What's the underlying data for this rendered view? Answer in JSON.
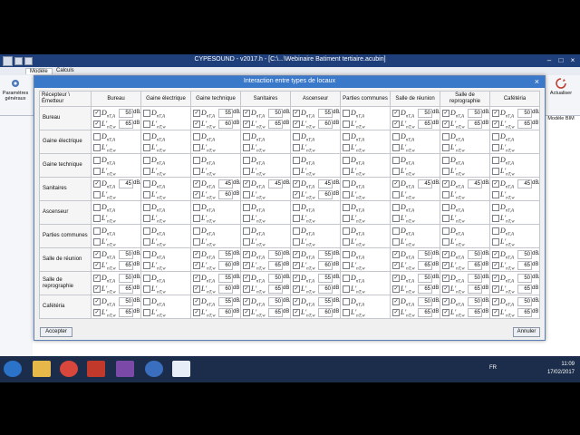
{
  "app": {
    "title": "CYPESOUND - v2017.h - [C:\\...\\Webinaire Batiment tertiaire.acubin]",
    "ribbon_tabs": [
      "Modèle",
      "Calculs"
    ],
    "ribbon_left_label": "Paramètres généraux",
    "ribbon_right_labels": [
      "Actualiser",
      "Modèle BIM"
    ]
  },
  "dialog": {
    "title": "Interaction entre types de locaux",
    "corner": "Récepteur \\ Émetteur",
    "accept_label": "Accepter",
    "cancel_label": "Annuler",
    "col_headers": [
      "Bureau",
      "Gaine électrique",
      "Gaine technique",
      "Sanitaires",
      "Ascenseur",
      "Parties communes",
      "Salle de réunion",
      "Salle de reprographie",
      "Cafétéria"
    ],
    "row_headers": [
      "Bureau",
      "Gaine électrique",
      "Gaine technique",
      "Sanitaires",
      "Ascenseur",
      "Parties communes",
      "Salle de réunion",
      "Salle de reprographie",
      "Cafétéria"
    ],
    "sym_d": "D",
    "sym_d_sub": "nT,A",
    "sym_l": "L'",
    "sym_l_sub": "nT,w",
    "unit_d": "dBA",
    "unit_l": "dB",
    "rows": [
      [
        {
          "d": "50",
          "l": "65"
        },
        {
          "d": "",
          "l": ""
        },
        {
          "d": "55",
          "l": "60"
        },
        {
          "d": "50",
          "l": "65"
        },
        {
          "d": "55",
          "l": "60"
        },
        {
          "d": "",
          "l": ""
        },
        {
          "d": "50",
          "l": "65"
        },
        {
          "d": "50",
          "l": "65"
        },
        {
          "d": "50",
          "l": "65"
        }
      ],
      [
        {
          "d": "",
          "l": ""
        },
        {
          "d": "",
          "l": ""
        },
        {
          "d": "",
          "l": ""
        },
        {
          "d": "",
          "l": ""
        },
        {
          "d": "",
          "l": ""
        },
        {
          "d": "",
          "l": ""
        },
        {
          "d": "",
          "l": ""
        },
        {
          "d": "",
          "l": ""
        },
        {
          "d": "",
          "l": ""
        }
      ],
      [
        {
          "d": "",
          "l": ""
        },
        {
          "d": "",
          "l": ""
        },
        {
          "d": "",
          "l": ""
        },
        {
          "d": "",
          "l": ""
        },
        {
          "d": "",
          "l": ""
        },
        {
          "d": "",
          "l": ""
        },
        {
          "d": "",
          "l": ""
        },
        {
          "d": "",
          "l": ""
        },
        {
          "d": "",
          "l": ""
        }
      ],
      [
        {
          "d": "45",
          "l": ""
        },
        {
          "d": "",
          "l": ""
        },
        {
          "d": "45",
          "l": "60"
        },
        {
          "d": "45",
          "l": ""
        },
        {
          "d": "45",
          "l": "60"
        },
        {
          "d": "",
          "l": ""
        },
        {
          "d": "45",
          "l": ""
        },
        {
          "d": "45",
          "l": ""
        },
        {
          "d": "45",
          "l": ""
        }
      ],
      [
        {
          "d": "",
          "l": ""
        },
        {
          "d": "",
          "l": ""
        },
        {
          "d": "",
          "l": ""
        },
        {
          "d": "",
          "l": ""
        },
        {
          "d": "",
          "l": ""
        },
        {
          "d": "",
          "l": ""
        },
        {
          "d": "",
          "l": ""
        },
        {
          "d": "",
          "l": ""
        },
        {
          "d": "",
          "l": ""
        }
      ],
      [
        {
          "d": "",
          "l": ""
        },
        {
          "d": "",
          "l": ""
        },
        {
          "d": "",
          "l": ""
        },
        {
          "d": "",
          "l": ""
        },
        {
          "d": "",
          "l": ""
        },
        {
          "d": "",
          "l": ""
        },
        {
          "d": "",
          "l": ""
        },
        {
          "d": "",
          "l": ""
        },
        {
          "d": "",
          "l": ""
        }
      ],
      [
        {
          "d": "50",
          "l": "65"
        },
        {
          "d": "",
          "l": ""
        },
        {
          "d": "55",
          "l": "60"
        },
        {
          "d": "50",
          "l": "65"
        },
        {
          "d": "55",
          "l": "60"
        },
        {
          "d": "",
          "l": ""
        },
        {
          "d": "50",
          "l": "65"
        },
        {
          "d": "50",
          "l": "65"
        },
        {
          "d": "50",
          "l": "65"
        }
      ],
      [
        {
          "d": "50",
          "l": "65"
        },
        {
          "d": "",
          "l": ""
        },
        {
          "d": "55",
          "l": "60"
        },
        {
          "d": "50",
          "l": "65"
        },
        {
          "d": "55",
          "l": "60"
        },
        {
          "d": "",
          "l": ""
        },
        {
          "d": "50",
          "l": "65"
        },
        {
          "d": "50",
          "l": "65"
        },
        {
          "d": "50",
          "l": "65"
        }
      ],
      [
        {
          "d": "50",
          "l": "65"
        },
        {
          "d": "",
          "l": ""
        },
        {
          "d": "55",
          "l": "60"
        },
        {
          "d": "50",
          "l": "65"
        },
        {
          "d": "55",
          "l": "60"
        },
        {
          "d": "",
          "l": ""
        },
        {
          "d": "50",
          "l": "65"
        },
        {
          "d": "50",
          "l": "65"
        },
        {
          "d": "50",
          "l": "65"
        }
      ]
    ]
  },
  "taskbar": {
    "lang": "FR",
    "time": "11:09",
    "date": "17/02/2017"
  },
  "colors": {
    "dialog_title": "#3a78c9",
    "app_title": "#1f3f7a",
    "taskbar": "#1b2d4a"
  }
}
